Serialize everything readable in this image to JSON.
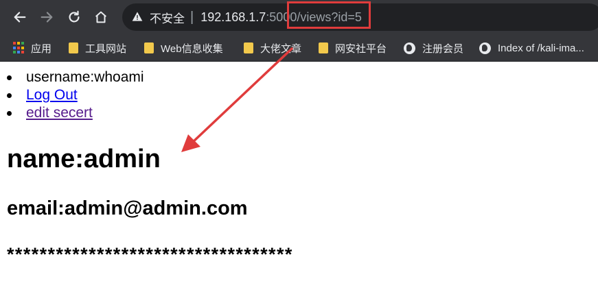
{
  "browser": {
    "security_label": "不安全",
    "url_host": "192.168.1.7",
    "url_rest": ":5000/views?id=5",
    "colors": {
      "toolbar": "#35363a",
      "omnibox": "#202124",
      "annotation": "#e03c3c"
    }
  },
  "bookmarks": [
    {
      "label": "应用",
      "icon": "apps-grid-icon"
    },
    {
      "label": "工具网站",
      "icon": "folder-icon"
    },
    {
      "label": "Web信息收集",
      "icon": "folder-icon"
    },
    {
      "label": "大佬文章",
      "icon": "folder-icon"
    },
    {
      "label": "网安社平台",
      "icon": "folder-icon"
    },
    {
      "label": "注册会员",
      "icon": "globe-icon"
    },
    {
      "label": "Index of /kali-ima...",
      "icon": "globe-icon"
    }
  ],
  "page": {
    "username": "username:whoami",
    "logout_link": "Log Out",
    "edit_link": "edit secert",
    "name_heading": "name:admin",
    "email_heading": "email:admin@admin.com",
    "secret_mask": "***********************************"
  }
}
